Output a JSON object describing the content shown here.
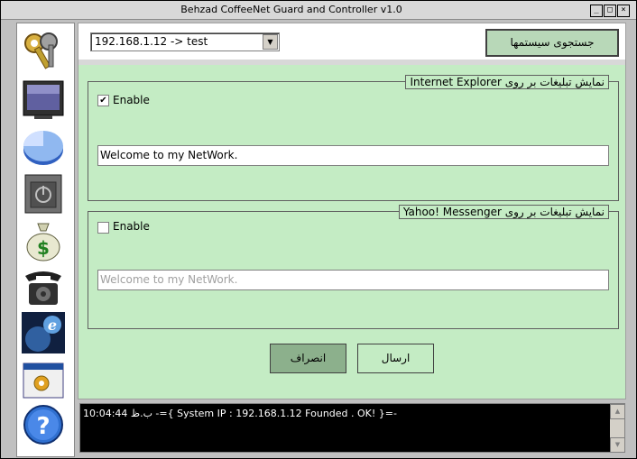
{
  "window": {
    "title": "Behzad CoffeeNet Guard and Controller v1.0",
    "min_glyph": "_",
    "max_glyph": "□",
    "close_glyph": "×"
  },
  "sidebar": {
    "items": [
      {
        "icon": "keys-icon"
      },
      {
        "icon": "monitor-icon"
      },
      {
        "icon": "pie-chart-icon"
      },
      {
        "icon": "power-icon"
      },
      {
        "icon": "money-bag-icon"
      },
      {
        "icon": "telephone-icon"
      },
      {
        "icon": "internet-explorer-icon"
      },
      {
        "icon": "settings-window-icon"
      },
      {
        "icon": "help-icon"
      }
    ]
  },
  "toolbar": {
    "system_select": "192.168.1.12 -> test",
    "search_label": "جستجوی سیستمها"
  },
  "ie_group": {
    "legend": "نمایش تبلیغات بر روی Internet Explorer",
    "enable_label": "Enable",
    "checked": true,
    "check_glyph": "✔",
    "message": "Welcome to my NetWork."
  },
  "yahoo_group": {
    "legend": "نمایش تبلیغات بر روی Yahoo! Messenger",
    "enable_label": "Enable",
    "checked": false,
    "message_placeholder": "Welcome to my NetWork."
  },
  "actions": {
    "cancel_label": "انصراف",
    "send_label": "ارسال"
  },
  "log": {
    "line": "10:04:44 ب.ظ  -={  System IP : 192.168.1.12 Founded . OK!  }=-"
  },
  "colors": {
    "panel_bg": "#c4ecc4",
    "button_bg": "#b8d8b8",
    "log_bg": "#000000"
  }
}
